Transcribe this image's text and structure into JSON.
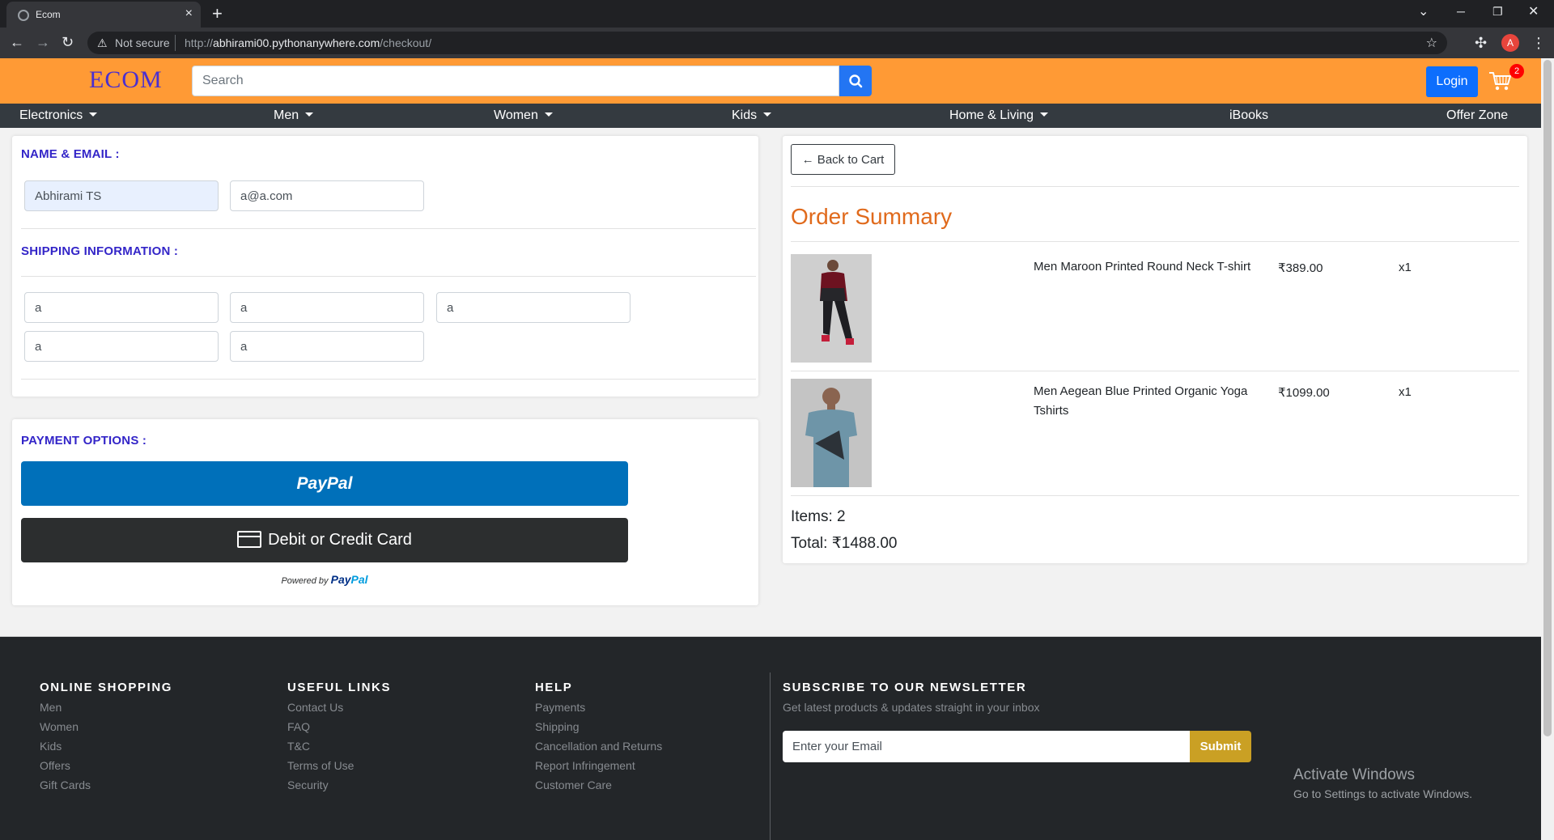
{
  "browser": {
    "tab_title": "Ecom",
    "security_label": "Not secure",
    "url_scheme": "http://",
    "url_host": "abhirami00.pythonanywhere.com",
    "url_path": "/checkout/",
    "profile_initial": "A"
  },
  "header": {
    "logo": "ECOM",
    "search_placeholder": "Search",
    "login_label": "Login",
    "cart_count": "2"
  },
  "nav": {
    "items": [
      {
        "label": "Electronics",
        "dropdown": true
      },
      {
        "label": "Men",
        "dropdown": true
      },
      {
        "label": "Women",
        "dropdown": true
      },
      {
        "label": "Kids",
        "dropdown": true
      },
      {
        "label": "Home & Living",
        "dropdown": true
      },
      {
        "label": "iBooks",
        "dropdown": false
      },
      {
        "label": "Offer Zone",
        "dropdown": false
      }
    ]
  },
  "checkout": {
    "name_email_title": "NAME & EMAIL :",
    "name_value": "Abhirami TS",
    "email_value": "a@a.com",
    "shipping_title": "SHIPPING INFORMATION :",
    "shipping_values": [
      "a",
      "a",
      "a",
      "a",
      "a"
    ]
  },
  "payment": {
    "title": "PAYMENT OPTIONS :",
    "paypal_label": "PayPal",
    "card_label": "Debit or Credit Card",
    "powered_by": "Powered by",
    "powered_brand_a": "Pay",
    "powered_brand_b": "Pal"
  },
  "summary": {
    "back_label": "← Back to Cart",
    "title": "Order Summary",
    "items": [
      {
        "name": "Men Maroon Printed Round Neck T-shirt",
        "price": "₹389.00",
        "qty": "x1",
        "image": "maroon-tshirt-model"
      },
      {
        "name": "Men Aegean Blue Printed Organic Yoga Tshirts",
        "price": "₹1099.00",
        "qty": "x1",
        "image": "blue-tshirt-model"
      }
    ],
    "items_count": "Items: 2",
    "total": "Total: ₹1488.00"
  },
  "footer": {
    "online_shopping": {
      "title": "ONLINE SHOPPING",
      "links": [
        "Men",
        "Women",
        "Kids",
        "Offers",
        "Gift Cards"
      ]
    },
    "useful_links": {
      "title": "USEFUL LINKS",
      "links": [
        "Contact Us",
        "FAQ",
        "T&C",
        "Terms of Use",
        "Security"
      ]
    },
    "help": {
      "title": "HELP",
      "links": [
        "Payments",
        "Shipping",
        "Cancellation and Returns",
        "Report Infringement",
        "Customer Care"
      ]
    },
    "newsletter": {
      "title": "SUBSCRIBE TO OUR NEWSLETTER",
      "subtitle": "Get latest products & updates straight in your inbox",
      "email_placeholder": "Enter your Email",
      "submit_label": "Submit"
    }
  },
  "watermark": {
    "line1": "Activate Windows",
    "line2": "Go to Settings to activate Windows."
  },
  "colors": {
    "header_bg": "#ff9a35",
    "nav_bg": "#343a40",
    "section_title": "#3325c8",
    "summary_title": "#e06a1c",
    "paypal_blue": "#0070ba",
    "submit_gold": "#caa024"
  }
}
